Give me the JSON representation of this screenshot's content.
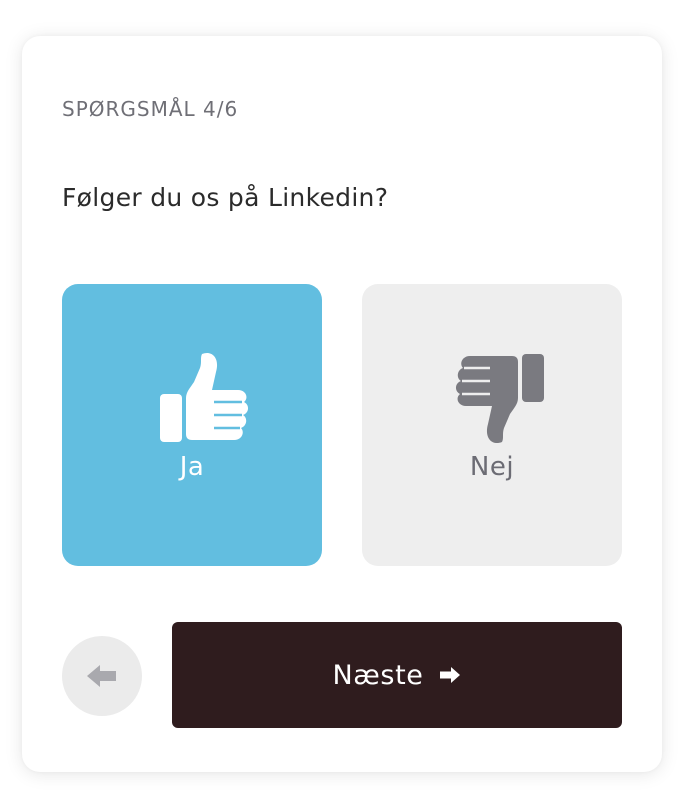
{
  "quiz": {
    "step_label": "SPØRGSMÅL 4/6",
    "question": "Følger du os på Linkedin?"
  },
  "options": [
    {
      "label": "Ja",
      "icon": "thumbs-up-icon",
      "selected": true,
      "color": "#62bee0"
    },
    {
      "label": "Nej",
      "icon": "thumbs-down-icon",
      "selected": false,
      "color": "#eeeeee"
    }
  ],
  "navigation": {
    "back_icon": "arrow-left-icon",
    "next_label": "Næste",
    "next_icon": "arrow-right-icon",
    "next_color": "#2f1c1e"
  }
}
